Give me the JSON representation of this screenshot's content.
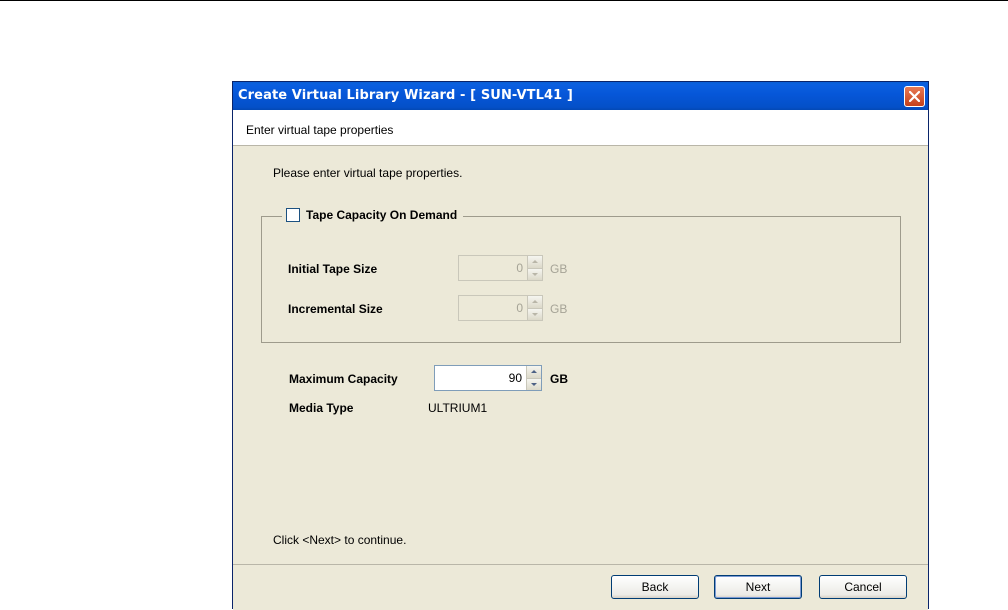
{
  "window": {
    "title": "Create Virtual Library Wizard - [ SUN-VTL41 ]",
    "close_icon": "close-icon"
  },
  "header": {
    "subtitle": "Enter virtual tape properties"
  },
  "content": {
    "instruction": "Please enter virtual tape properties.",
    "tape_capacity_group": {
      "checkbox_label": "Tape Capacity On Demand",
      "checked": false,
      "initial_tape_size": {
        "label": "Initial Tape Size",
        "value": "0",
        "unit": "GB",
        "enabled": false
      },
      "incremental_size": {
        "label": "Incremental Size",
        "value": "0",
        "unit": "GB",
        "enabled": false
      }
    },
    "maximum_capacity": {
      "label": "Maximum Capacity",
      "value": "90",
      "unit": "GB"
    },
    "media_type": {
      "label": "Media Type",
      "value": "ULTRIUM1"
    },
    "footer_hint": "Click <Next> to continue."
  },
  "buttons": {
    "back": "Back",
    "next": "Next",
    "cancel": "Cancel"
  },
  "colors": {
    "titlebar": "#0656d8",
    "dialog_bg": "#ece9d8",
    "close_button": "#d4552c"
  }
}
